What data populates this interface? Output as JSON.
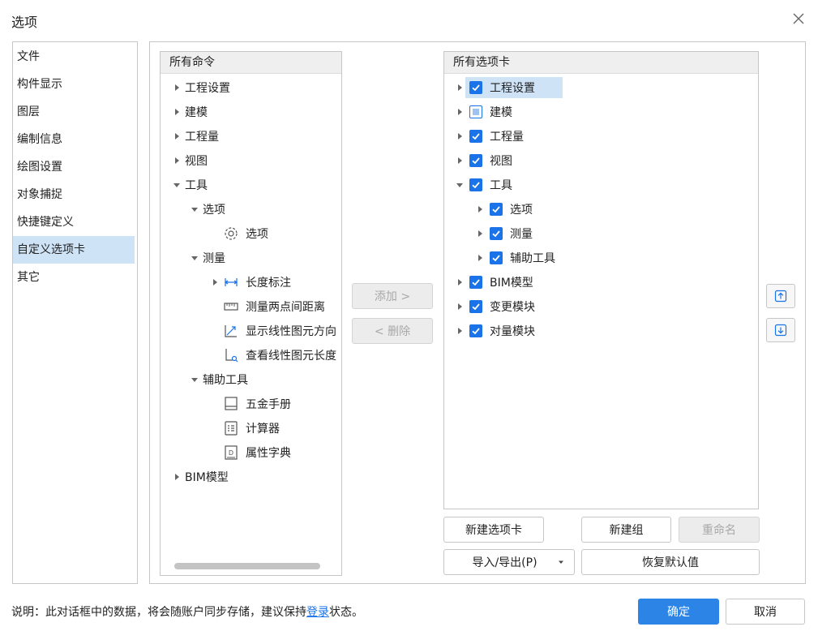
{
  "dialog": {
    "title": "选项"
  },
  "sidebar": {
    "items": [
      {
        "label": "文件",
        "active": false
      },
      {
        "label": "构件显示",
        "active": false
      },
      {
        "label": "图层",
        "active": false
      },
      {
        "label": "编制信息",
        "active": false
      },
      {
        "label": "绘图设置",
        "active": false
      },
      {
        "label": "对象捕捉",
        "active": false
      },
      {
        "label": "快捷键定义",
        "active": false
      },
      {
        "label": "自定义选项卡",
        "active": true
      },
      {
        "label": "其它",
        "active": false
      }
    ]
  },
  "left_panel": {
    "header": "所有命令",
    "items": [
      {
        "label": "工程设置",
        "arrow": "right",
        "icon": null
      },
      {
        "label": "建模",
        "arrow": "right",
        "icon": null
      },
      {
        "label": "工程量",
        "arrow": "right",
        "icon": null
      },
      {
        "label": "视图",
        "arrow": "right",
        "icon": null
      },
      {
        "label": "工具",
        "arrow": "down",
        "icon": null
      },
      {
        "label": "选项",
        "arrow": "down",
        "icon": null
      },
      {
        "label": "选项",
        "arrow": null,
        "icon": "gear-icon"
      },
      {
        "label": "测量",
        "arrow": "down",
        "icon": null
      },
      {
        "label": "长度标注",
        "arrow": "right",
        "icon": "dimension-icon"
      },
      {
        "label": "测量两点间距离",
        "arrow": null,
        "icon": "ruler-icon"
      },
      {
        "label": "显示线性图元方向",
        "arrow": null,
        "icon": "direction-icon"
      },
      {
        "label": "查看线性图元长度",
        "arrow": null,
        "icon": "length-view-icon"
      },
      {
        "label": "辅助工具",
        "arrow": "down",
        "icon": null
      },
      {
        "label": "五金手册",
        "arrow": null,
        "icon": "handbook-icon"
      },
      {
        "label": "计算器",
        "arrow": null,
        "icon": "calculator-icon"
      },
      {
        "label": "属性字典",
        "arrow": null,
        "icon": "dictionary-icon"
      },
      {
        "label": "BIM模型",
        "arrow": "right",
        "icon": null
      }
    ]
  },
  "middle_buttons": {
    "add": "添加 >",
    "remove": "< 删除"
  },
  "right_panel": {
    "header": "所有选项卡",
    "items": [
      {
        "label": "工程设置",
        "arrow": "right",
        "check": "on",
        "selected": true
      },
      {
        "label": "建模",
        "arrow": "right",
        "check": "partial",
        "selected": false
      },
      {
        "label": "工程量",
        "arrow": "right",
        "check": "on",
        "selected": false
      },
      {
        "label": "视图",
        "arrow": "right",
        "check": "on",
        "selected": false
      },
      {
        "label": "工具",
        "arrow": "down",
        "check": "on",
        "selected": false
      },
      {
        "label": "选项",
        "arrow": "right",
        "check": "on",
        "selected": false
      },
      {
        "label": "测量",
        "arrow": "right",
        "check": "on",
        "selected": false
      },
      {
        "label": "辅助工具",
        "arrow": "right",
        "check": "on",
        "selected": false
      },
      {
        "label": "BIM模型",
        "arrow": "right",
        "check": "on",
        "selected": false
      },
      {
        "label": "变更模块",
        "arrow": "right",
        "check": "on",
        "selected": false
      },
      {
        "label": "对量模块",
        "arrow": "right",
        "check": "on",
        "selected": false
      }
    ]
  },
  "right_buttons": {
    "new_tab": "新建选项卡",
    "new_group": "新建组",
    "rename": "重命名",
    "import_export": "导入/导出(P)",
    "restore_default": "恢复默认值"
  },
  "footer": {
    "note_prefix": "说明：此对话框中的数据，将会随账户同步存储，建议保持",
    "note_link": "登录",
    "note_suffix": "状态。",
    "ok": "确定",
    "cancel": "取消"
  },
  "colors": {
    "accent": "#2b84e6",
    "selection": "#cfe3f7",
    "check": "#1a73e8",
    "link": "#1a73e8"
  }
}
